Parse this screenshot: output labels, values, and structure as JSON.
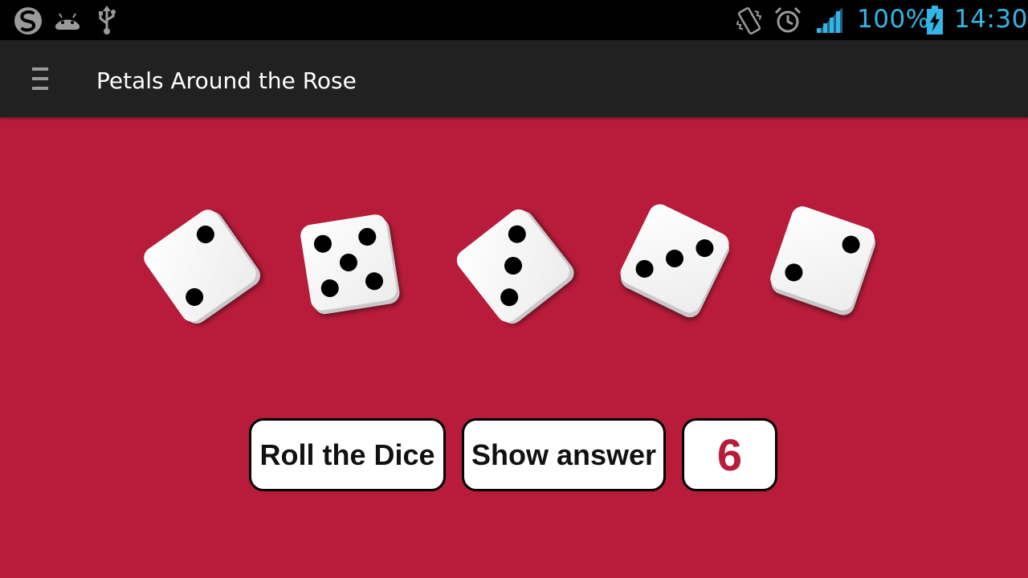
{
  "status_bar": {
    "battery_percent": "100%",
    "time": "14:30",
    "accent_color": "#33b5e5",
    "icons": [
      "swype-icon",
      "android-debug-icon",
      "usb-icon",
      "vibrate-icon",
      "alarm-icon",
      "signal-icon",
      "battery-charging-icon"
    ]
  },
  "action_bar": {
    "title": "Petals Around the Rose",
    "menu_icon": "hamburger-menu-icon"
  },
  "game": {
    "background_color": "#b81c3a",
    "dice_values": [
      2,
      5,
      3,
      3,
      2
    ],
    "roll_button": "Roll the Dice",
    "show_answer_button": "Show answer",
    "answer": "6",
    "answer_color": "#b81c3a"
  }
}
